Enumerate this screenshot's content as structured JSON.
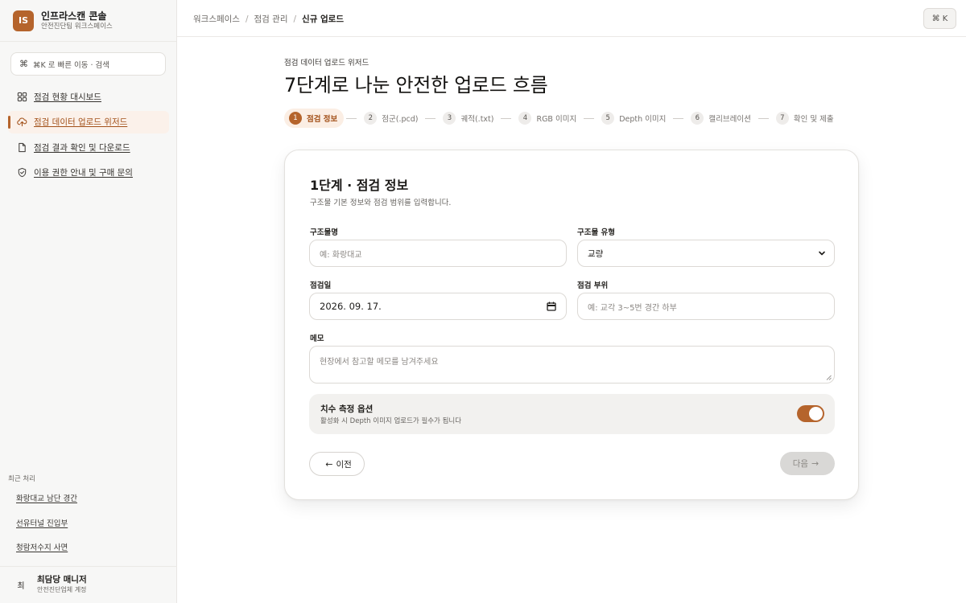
{
  "app": {
    "logo_text": "IS",
    "name": "인프라스캔 콘솔",
    "workspace": "안전진단팀 워크스페이스"
  },
  "search": {
    "icon": "command-icon",
    "placeholder": "⌘K 로 빠른 이동 · 검색"
  },
  "sidebar": {
    "items": [
      {
        "label": "점검 현황 대시보드",
        "icon": "grid-icon",
        "active": false
      },
      {
        "label": "점검 데이터 업로드 위저드",
        "icon": "upload-cloud-icon",
        "active": true
      },
      {
        "label": "점검 결과 확인 및 다운로드",
        "icon": "document-icon",
        "active": false
      },
      {
        "label": "이용 권한 안내 및 구매 문의",
        "icon": "shield-check-icon",
        "active": false
      }
    ],
    "recent_title": "최근 처리",
    "recent": [
      "화랑대교 남단 경간",
      "선유터널 진입부",
      "청람저수지 사면"
    ]
  },
  "user": {
    "avatar": "최",
    "name": "최담당 매니저",
    "account": "안전진단업체 계정"
  },
  "breadcrumb": [
    "워크스페이스",
    "점검 관리",
    "신규 업로드"
  ],
  "shortcut": "⌘ K",
  "header": {
    "eyebrow": "점검 데이터 업로드 위저드",
    "title": "7단계로 나눈 안전한 업로드 흐름"
  },
  "steps": [
    {
      "num": "1",
      "label": "점검 정보",
      "active": true
    },
    {
      "num": "2",
      "label": "점군(.pcd)",
      "active": false
    },
    {
      "num": "3",
      "label": "궤적(.txt)",
      "active": false
    },
    {
      "num": "4",
      "label": "RGB 이미지",
      "active": false
    },
    {
      "num": "5",
      "label": "Depth 이미지",
      "active": false
    },
    {
      "num": "6",
      "label": "캘리브레이션",
      "active": false
    },
    {
      "num": "7",
      "label": "확인 및 제출",
      "active": false
    }
  ],
  "form": {
    "title": "1단계 · 점검 정보",
    "description": "구조물 기본 정보와 점검 범위를 입력합니다.",
    "structure_name": {
      "label": "구조물명",
      "placeholder": "예: 화랑대교",
      "value": ""
    },
    "structure_type": {
      "label": "구조물 유형",
      "value": "교량"
    },
    "inspection_date": {
      "label": "점검일",
      "value": "2026. 09. 17."
    },
    "inspection_area": {
      "label": "점검 부위",
      "placeholder": "예: 교각 3~5번 경간 하부",
      "value": ""
    },
    "memo": {
      "label": "메모",
      "placeholder": "현장에서 참고할 메모를 남겨주세요"
    },
    "measure_option": {
      "title": "치수 측정 옵션",
      "description": "활성화 시 Depth 이미지 업로드가 필수가 됩니다",
      "enabled": true
    },
    "prev_button": "이전",
    "next_button": "다음"
  },
  "colors": {
    "accent": "#b5642c",
    "accent_soft": "#fbeee4",
    "disabled": "#d9d8d6"
  }
}
